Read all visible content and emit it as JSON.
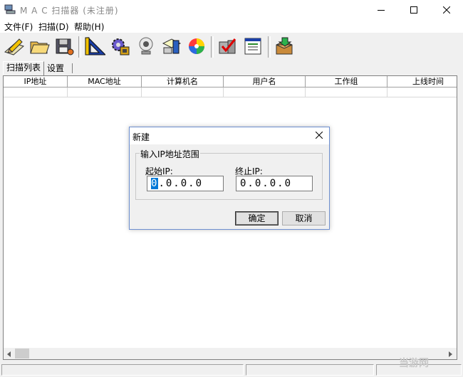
{
  "window": {
    "title": "M A C 扫描器  (未注册)"
  },
  "menu": [
    "文件(F)",
    "扫描(D)",
    "帮助(H)"
  ],
  "toolbar": {
    "buttons": [
      "pencil-icon",
      "open-folder-icon",
      "save-disk-icon",
      "ruler-triangle-icon",
      "gear-chip-icon",
      "webcam-icon",
      "pc-user-icon",
      "color-wheel-icon",
      "computer-check-icon",
      "list-window-icon",
      "box-export-icon"
    ]
  },
  "tabs": [
    "扫描列表",
    "设置"
  ],
  "table": {
    "columns": [
      "IP地址",
      "MAC地址",
      "计算机名",
      "用户名",
      "工作组",
      "上线时间"
    ]
  },
  "watermark": "当游网",
  "dialog": {
    "title": "新建",
    "group_label": "输入IP地址范围",
    "start_label": "起始IP:",
    "end_label": "终止IP:",
    "start_ip": [
      "0",
      ".0.0.0"
    ],
    "end_ip": "0.0.0.0",
    "ok": "确定",
    "cancel": "取消"
  }
}
